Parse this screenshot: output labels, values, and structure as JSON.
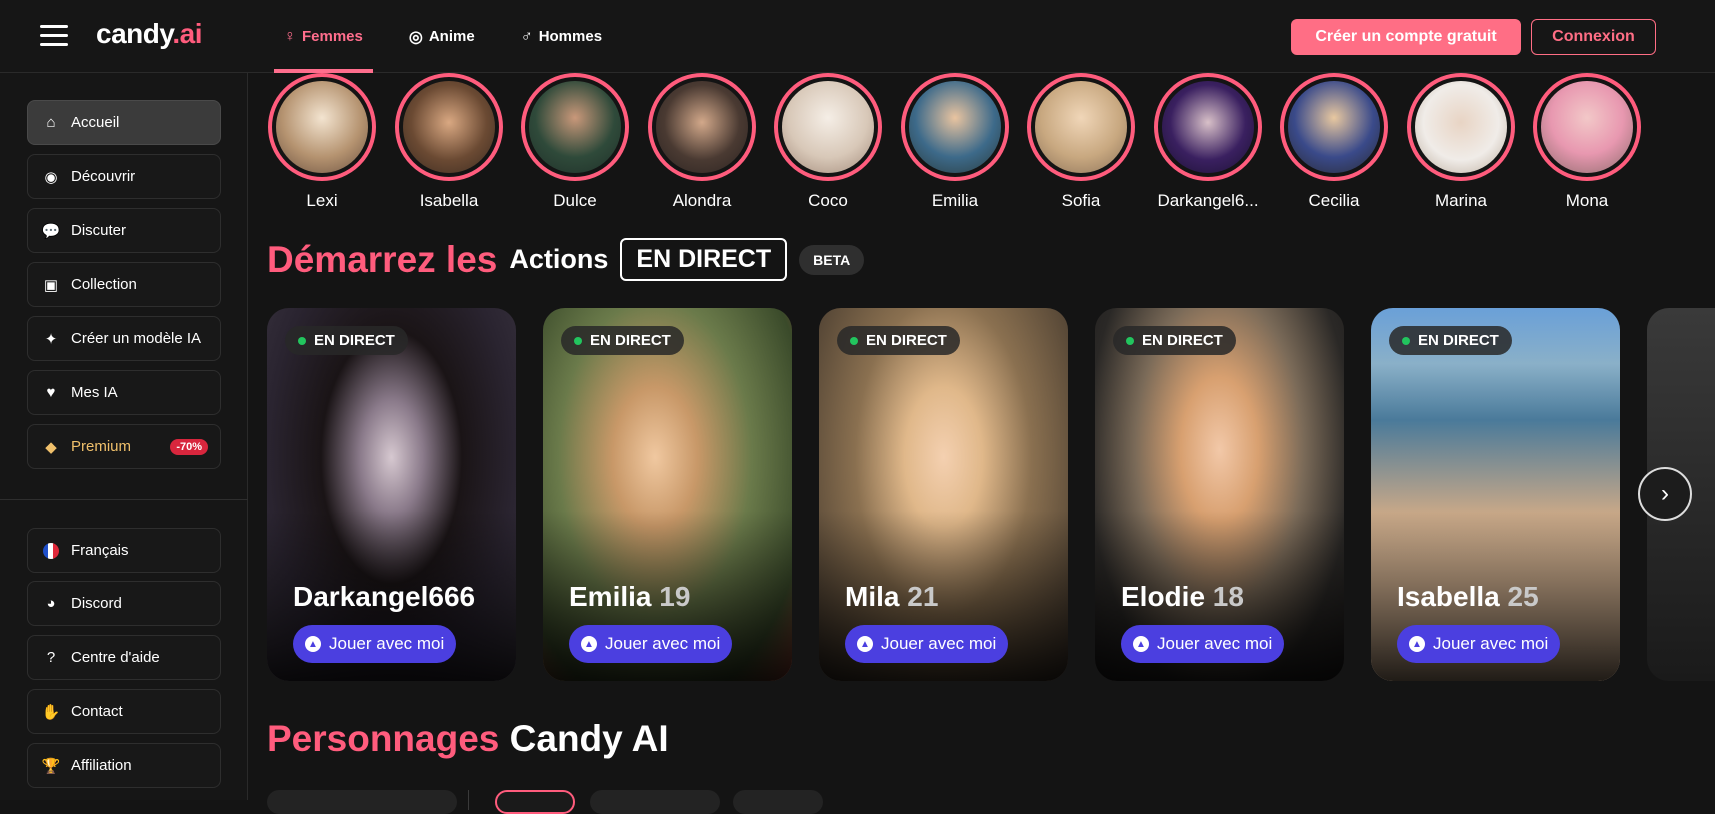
{
  "header": {
    "logo_text": "candy",
    "logo_accent": ".ai",
    "nav": [
      {
        "label": "Femmes",
        "icon": "female-icon",
        "active": true
      },
      {
        "label": "Anime",
        "icon": "spiral-icon",
        "active": false
      },
      {
        "label": "Hommes",
        "icon": "male-icon",
        "active": false
      }
    ],
    "signup_label": "Créer un compte gratuit",
    "login_label": "Connexion"
  },
  "sidebar": {
    "items": [
      {
        "label": "Accueil",
        "icon": "home-icon"
      },
      {
        "label": "Découvrir",
        "icon": "compass-icon"
      },
      {
        "label": "Discuter",
        "icon": "chat-icon"
      },
      {
        "label": "Collection",
        "icon": "gallery-icon"
      },
      {
        "label": "Créer un modèle IA",
        "icon": "magic-wand-icon"
      },
      {
        "label": "Mes IA",
        "icon": "heart-icon"
      },
      {
        "label": "Premium",
        "icon": "diamond-icon",
        "badge": "-70%"
      }
    ],
    "bottom_items": [
      {
        "label": "Français",
        "icon": "french-flag-icon"
      },
      {
        "label": "Discord",
        "icon": "discord-icon"
      },
      {
        "label": "Centre d'aide",
        "icon": "help-icon"
      },
      {
        "label": "Contact",
        "icon": "handshake-icon"
      },
      {
        "label": "Affiliation",
        "icon": "trophy-icon"
      }
    ]
  },
  "stories": [
    "Lexi",
    "Isabella",
    "Dulce",
    "Alondra",
    "Coco",
    "Emilia",
    "Sofia",
    "Darkangel6...",
    "Cecilia",
    "Marina",
    "Mona"
  ],
  "live_section": {
    "title_pink": "Démarrez les",
    "title_white": "Actions",
    "live_box": "EN DIRECT",
    "beta": "BETA"
  },
  "live_cards": [
    {
      "name": "Darkangel666",
      "age": "",
      "badge": "EN DIRECT",
      "button": "Jouer avec moi"
    },
    {
      "name": "Emilia",
      "age": "19",
      "badge": "EN DIRECT",
      "button": "Jouer avec moi"
    },
    {
      "name": "Mila",
      "age": "21",
      "badge": "EN DIRECT",
      "button": "Jouer avec moi"
    },
    {
      "name": "Elodie",
      "age": "18",
      "badge": "EN DIRECT",
      "button": "Jouer avec moi"
    },
    {
      "name": "Isabella",
      "age": "25",
      "badge": "EN DIRECT",
      "button": "Jouer avec moi"
    }
  ],
  "characters_section": {
    "title_pink": "Personnages",
    "title_white": "Candy AI"
  },
  "colors": {
    "accent": "#ff5c7d",
    "button_purple": "#4b3fe0",
    "live_dot": "#22c55e",
    "premium_gold": "#f0c06b"
  }
}
